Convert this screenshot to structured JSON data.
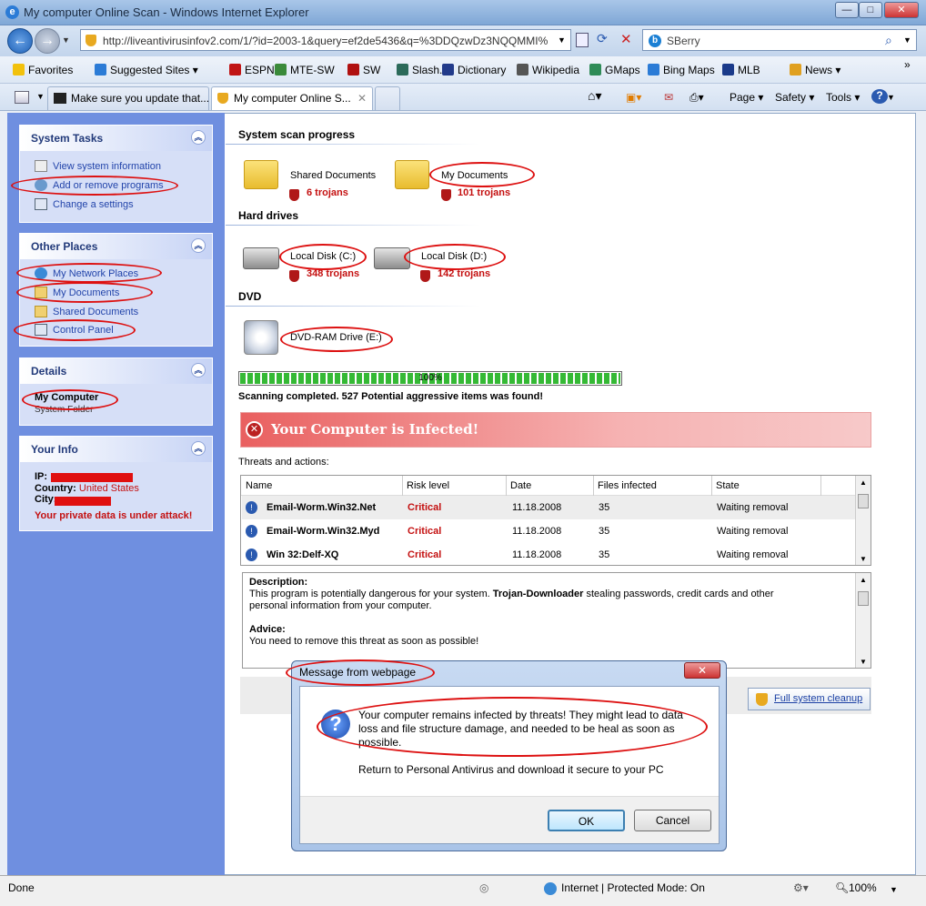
{
  "window": {
    "title": "My computer Online Scan - Windows Internet Explorer",
    "min": "—",
    "max": "□",
    "close": "✕"
  },
  "address": {
    "url": "http://liveantivirusinfov2.com/1/?id=2003-1&query=ef2de5436&q=%3DDQzwDz3NQQMMI%",
    "search": "SBerry"
  },
  "favbar": [
    {
      "label": "Favorites",
      "color": "#f2c10c"
    },
    {
      "label": "Suggested Sites ▾",
      "color": "#2b7bd6"
    },
    {
      "label": "ESPN",
      "color": "#c01414"
    },
    {
      "label": "MTE-SW",
      "color": "#3a8a3a"
    },
    {
      "label": "SW",
      "color": "#b01010"
    },
    {
      "label": "Slash.",
      "color": "#2c6a5a"
    },
    {
      "label": "Dictionary",
      "color": "#223a8a"
    },
    {
      "label": "Wikipedia",
      "color": "#555555"
    },
    {
      "label": "GMaps",
      "color": "#2e8b57"
    },
    {
      "label": "Bing Maps",
      "color": "#2b7bd6"
    },
    {
      "label": "MLB",
      "color": "#1a3a8a"
    },
    {
      "label": "News ▾",
      "color": "#e0a020"
    }
  ],
  "tabs": [
    {
      "label": "Make sure you update that..."
    },
    {
      "label": "My computer Online S..."
    }
  ],
  "toolbar": {
    "page": "Page ▾",
    "safety": "Safety ▾",
    "tools": "Tools ▾",
    "help": "?▾"
  },
  "panels": {
    "system_tasks": {
      "title": "System Tasks",
      "items": [
        "View system information",
        "Add or remove programs",
        "Change a settings"
      ]
    },
    "other_places": {
      "title": "Other Places",
      "items": [
        "My Network Places",
        "My Documents",
        "Shared Documents",
        "Control Panel"
      ]
    },
    "details": {
      "title": "Details",
      "name": "My Computer",
      "sub": "System Folder"
    },
    "your_info": {
      "title": "Your Info",
      "ip_label": "IP:",
      "country_label": "Country:",
      "country": "United States",
      "city_label": "City:",
      "warning": "Your private data is under attack!"
    }
  },
  "scan": {
    "progress_title": "System scan progress",
    "folders": [
      {
        "name": "Shared Documents",
        "trojans": "6 trojans"
      },
      {
        "name": "My Documents",
        "trojans": "101 trojans"
      }
    ],
    "hard_drives_title": "Hard drives",
    "drives": [
      {
        "name": "Local Disk (C:)",
        "trojans": "348 trojans"
      },
      {
        "name": "Local Disk (D:)",
        "trojans": "142 trojans"
      }
    ],
    "dvd_title": "DVD",
    "dvd": "DVD-RAM Drive (E:)",
    "progress": 1.0,
    "progress_label": "100%",
    "completed": "Scanning completed. 527 Potential aggressive items was found!",
    "infected": "Your Computer is Infected!"
  },
  "threats": {
    "title": "Threats and actions:",
    "columns": [
      "Name",
      "Risk level",
      "Date",
      "Files infected",
      "State"
    ],
    "rows": [
      {
        "name": "Email-Worm.Win32.Net",
        "risk": "Critical",
        "date": "11.18.2008",
        "files": "35",
        "state": "Waiting removal"
      },
      {
        "name": "Email-Worm.Win32.Myd",
        "risk": "Critical",
        "date": "11.18.2008",
        "files": "35",
        "state": "Waiting removal"
      },
      {
        "name": "Win 32:Delf-XQ",
        "risk": "Critical",
        "date": "11.18.2008",
        "files": "35",
        "state": "Waiting removal"
      }
    ]
  },
  "description": {
    "label": "Description:",
    "text_pre": "This program is potentially dangerous for your system. ",
    "text_bold": "Trojan-Downloader",
    "text_post": " stealing passwords, credit cards and other personal information from your computer.",
    "advice_label": "Advice:",
    "advice": "You need to remove this threat as soon as possible!"
  },
  "cleanup_button": "Full system cleanup",
  "dialog": {
    "title": "Message from webpage",
    "close": "✕",
    "message": "Your computer remains infected by threats! They might lead to data loss and file structure damage, and needed to be heal as soon as possible.",
    "message2": "Return to Personal Antivirus and download it secure to your PC",
    "ok": "OK",
    "cancel": "Cancel"
  },
  "statusbar": {
    "left": "Done",
    "zone": "Internet | Protected Mode: On",
    "zoom": "100%"
  },
  "colors": {
    "critical": "#c41010",
    "link": "#2244aa",
    "annotation": "#dd1111"
  }
}
